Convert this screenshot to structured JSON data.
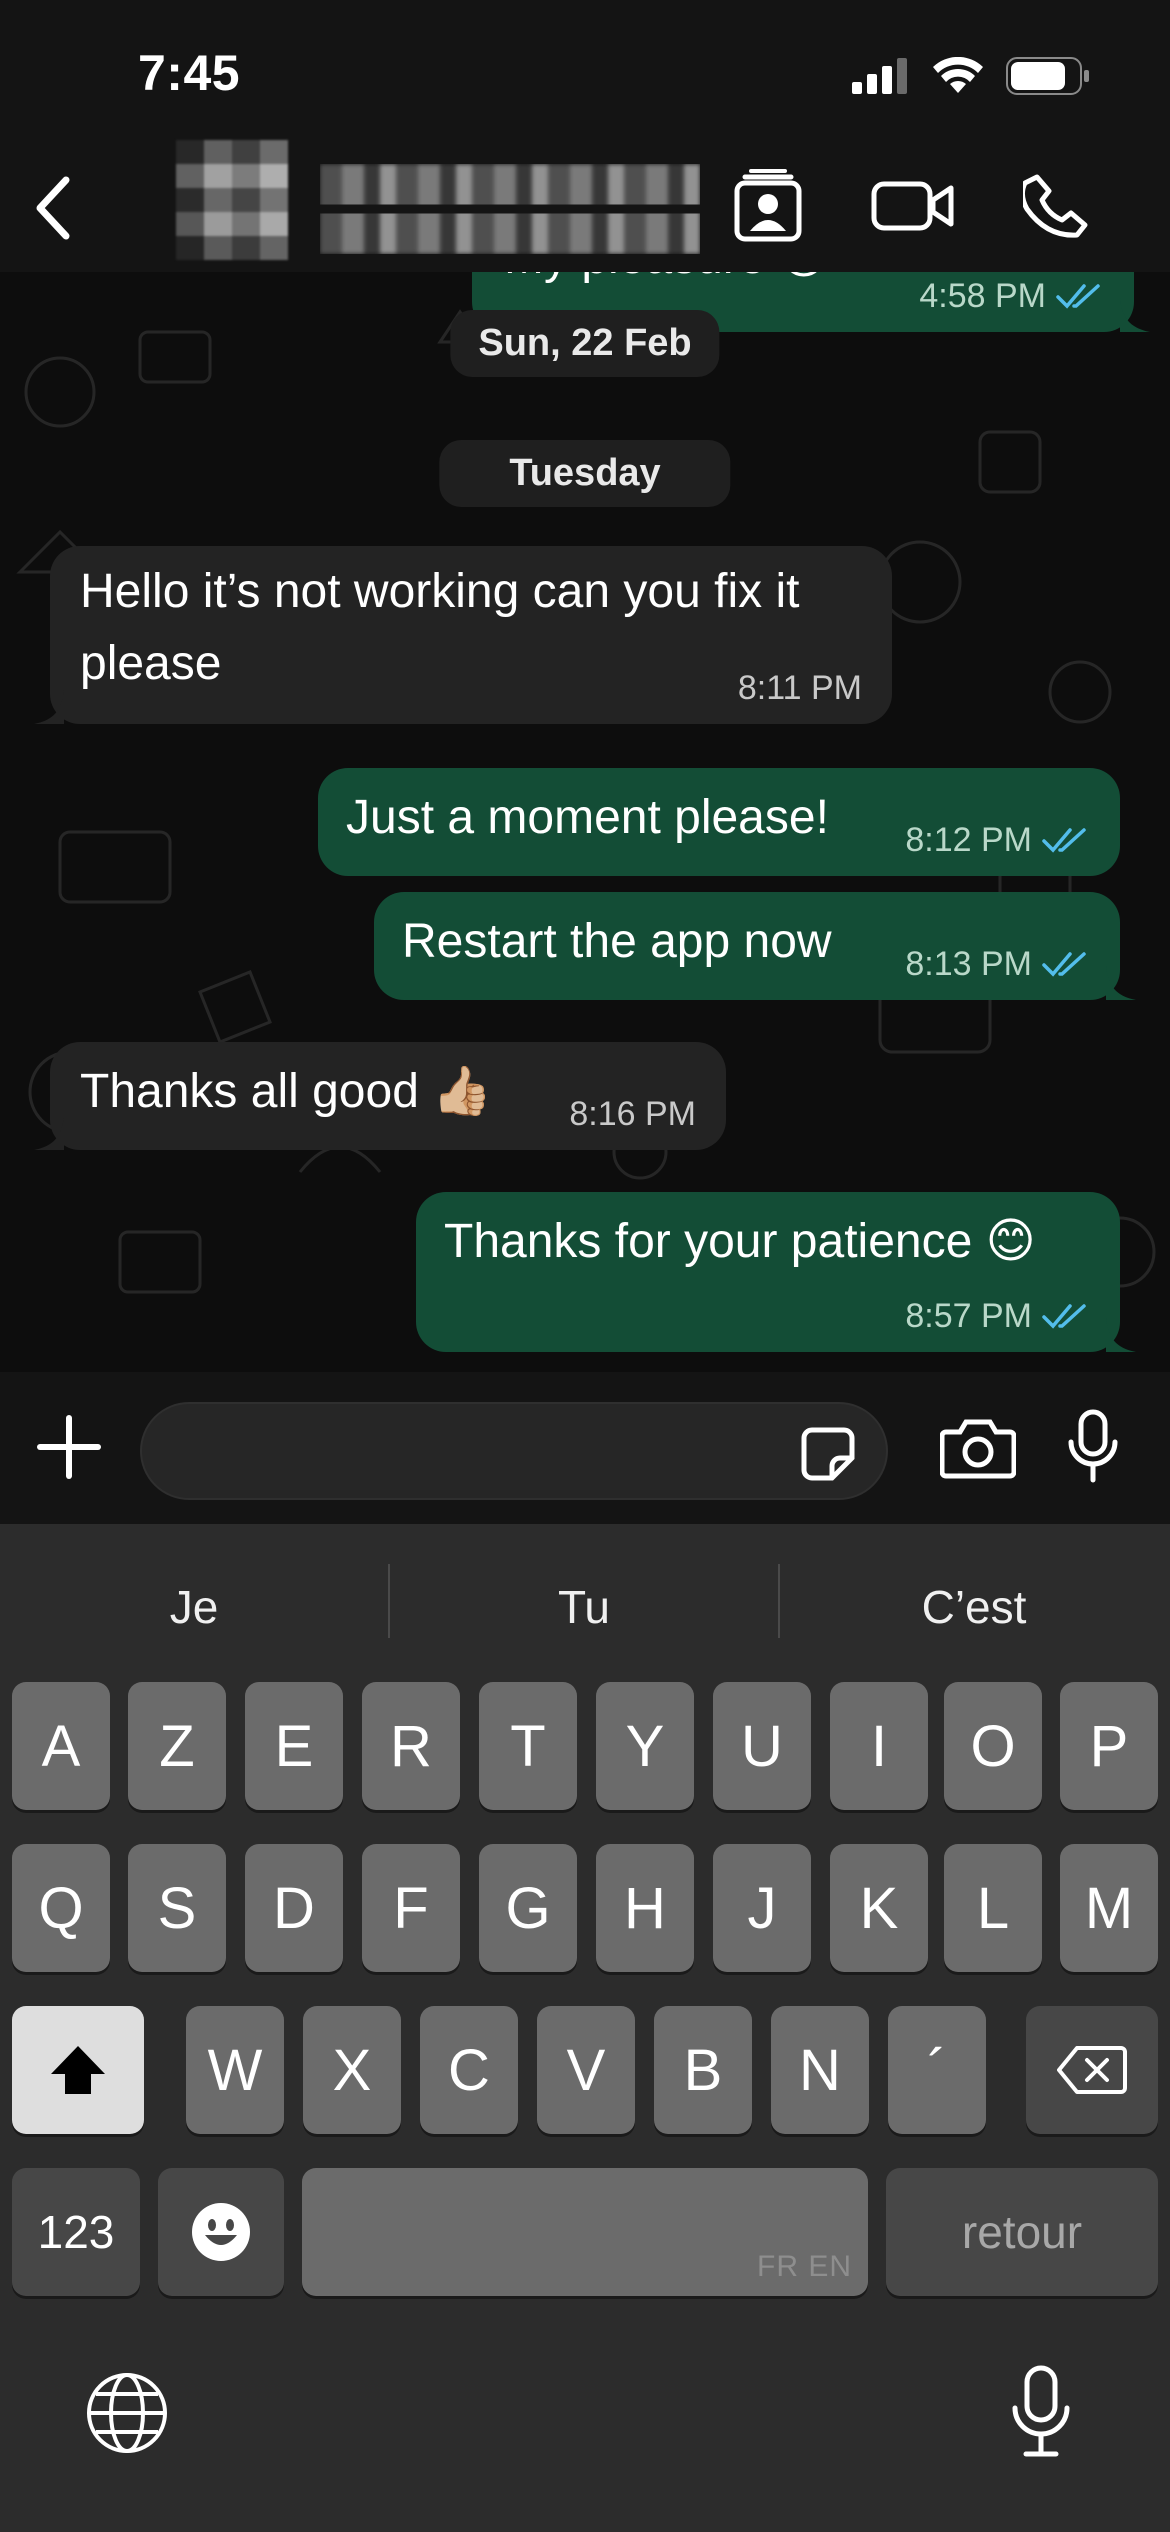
{
  "status_bar": {
    "time": "7:45"
  },
  "header": {
    "back_label": "back",
    "contact_name_hidden": true
  },
  "chat": {
    "messages": [
      {
        "direction": "out",
        "text": "My pleasure 😊",
        "time": "4:58 PM",
        "read": true,
        "partially_visible": true
      },
      {
        "direction": "in",
        "text": "Hello it’s not working can you fix it please",
        "time": "8:11 PM"
      },
      {
        "direction": "out",
        "text": "Just a moment please!",
        "time": "8:12 PM",
        "read": true
      },
      {
        "direction": "out",
        "text": "Restart the app now",
        "time": "8:13 PM",
        "read": true
      },
      {
        "direction": "in",
        "text": "Thanks all good 👍🏼",
        "time": "8:16 PM"
      },
      {
        "direction": "out",
        "text": "Thanks for your patience 😊",
        "time": "8:57 PM",
        "read": true
      }
    ],
    "date_separators": [
      "Sun, 22 Feb",
      "Tuesday"
    ]
  },
  "keyboard": {
    "suggestions": [
      "Je",
      "Tu",
      "C’est"
    ],
    "row1": [
      "A",
      "Z",
      "E",
      "R",
      "T",
      "Y",
      "U",
      "I",
      "O",
      "P"
    ],
    "row2": [
      "Q",
      "S",
      "D",
      "F",
      "G",
      "H",
      "J",
      "K",
      "L",
      "M"
    ],
    "row3": [
      "W",
      "X",
      "C",
      "V",
      "B",
      "N",
      "´"
    ],
    "numbers_label": "123",
    "space_languages": "FR EN",
    "return_label": "retour"
  },
  "colors": {
    "outgoing_bubble": "#134d36",
    "incoming_bubble": "#232323",
    "read_ticks": "#53bdeb",
    "keyboard_bg": "#2c2c2c"
  },
  "icons": [
    "back-chevron-icon",
    "contact-card-icon",
    "video-call-icon",
    "phone-icon",
    "plus-icon",
    "sticker-icon",
    "camera-icon",
    "mic-icon",
    "shift-icon",
    "backspace-icon",
    "emoji-icon",
    "globe-icon",
    "dictation-mic-icon"
  ]
}
